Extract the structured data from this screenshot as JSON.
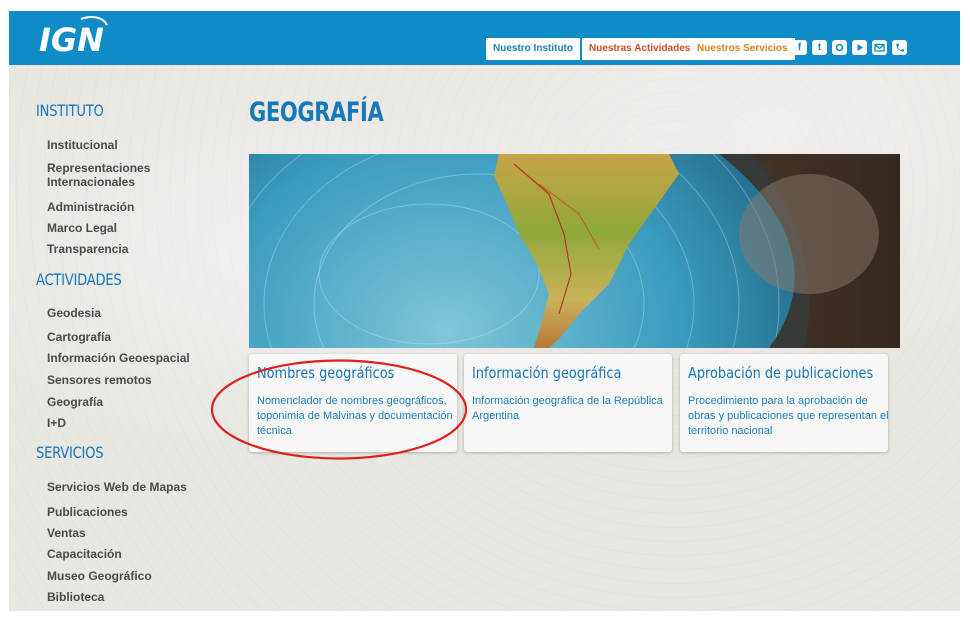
{
  "header": {
    "logo_text": "IGN",
    "nav": [
      "Nuestro Instituto",
      "Nuestras Actividades",
      "Nuestros Servicios"
    ],
    "social_icons": [
      "facebook-icon",
      "twitter-icon",
      "instagram-icon",
      "youtube-icon",
      "email-icon",
      "phone-icon"
    ],
    "brand_color": "#0f8bc7"
  },
  "sidebar": {
    "sections": [
      {
        "title": "INSTITUTO",
        "items": [
          "Institucional",
          "Representaciones Internacionales",
          "Administración",
          "Marco Legal",
          "Transparencia"
        ]
      },
      {
        "title": "ACTIVIDADES",
        "items": [
          "Geodesia",
          "Cartografía",
          "Información Geoespacial",
          "Sensores remotos",
          "Geografía",
          "I+D"
        ]
      },
      {
        "title": "SERVICIOS",
        "items": [
          "Servicios Web de Mapas",
          "Publicaciones",
          "Ventas",
          "Capacitación",
          "Museo Geográfico",
          "Biblioteca"
        ]
      }
    ]
  },
  "main": {
    "title": "GEOGRAFÍA",
    "cards": [
      {
        "title": "Nombres geográficos",
        "desc": "Nomenclador de nombres geográficos, toponimia de Malvinas y documentación técnica"
      },
      {
        "title": "Información geográfica",
        "desc": "Información geográfica de la República Argentina"
      },
      {
        "title": "Aprobación de publicaciones",
        "desc": "Procedimiento para la aprobación de obras y publicaciones que representan el territorio nacional"
      }
    ]
  },
  "annotation": {
    "color": "#e0201b"
  }
}
